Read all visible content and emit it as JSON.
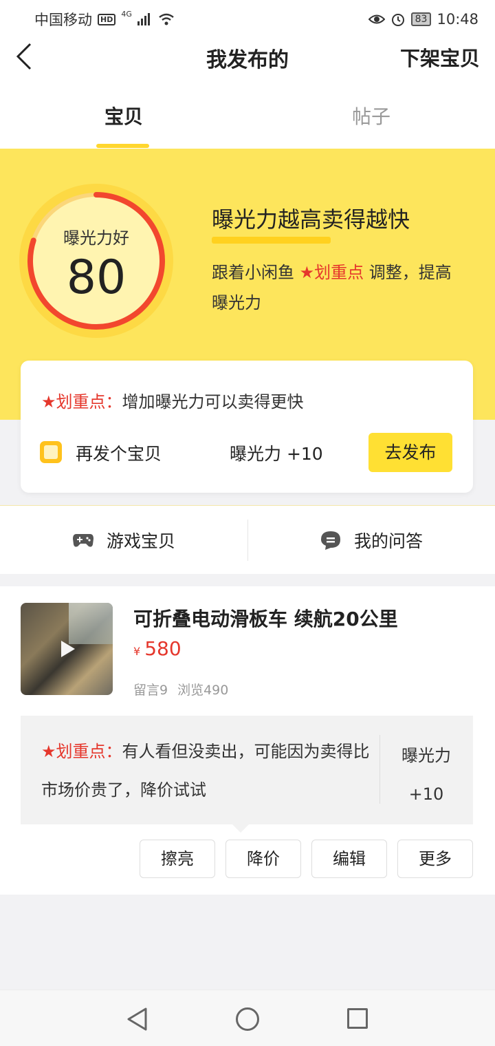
{
  "status_bar": {
    "carrier": "中国移动",
    "hd": "HD",
    "signal": "4G",
    "battery": "83",
    "time": "10:48"
  },
  "header": {
    "title": "我发布的",
    "action": "下架宝贝"
  },
  "tabs": [
    {
      "label": "宝贝",
      "active": true
    },
    {
      "label": "帖子",
      "active": false
    }
  ],
  "exposure": {
    "label": "曝光力好",
    "score": 80,
    "score_text": "80",
    "headline": "曝光力越高卖得越快",
    "desc_prefix": "跟着小闲鱼 ",
    "desc_highlight": "★划重点",
    "desc_suffix": " 调整，提高曝光力"
  },
  "tip_card": {
    "tag": "★划重点：",
    "text": "增加曝光力可以卖得更快",
    "repost_label": "再发个宝贝",
    "repost_gain": "曝光力 +10",
    "publish_button": "去发布"
  },
  "shortcuts": [
    {
      "label": "游戏宝贝",
      "icon": "gamepad-icon"
    },
    {
      "label": "我的问答",
      "icon": "chat-bubble-icon"
    }
  ],
  "item": {
    "title": "可折叠电动滑板车 续航20公里",
    "currency": "¥",
    "price": "580",
    "comments": "留言9",
    "views": "浏览490",
    "advice_tag": "★划重点：",
    "advice_text": "有人看但没卖出，可能因为卖得比市场价贵了，降价试试",
    "advice_gain_label": "曝光力",
    "advice_gain_value": "+10",
    "actions": [
      "擦亮",
      "降价",
      "编辑",
      "更多"
    ]
  },
  "colors": {
    "brand_yellow": "#fde55c",
    "button_yellow": "#ffe033",
    "accent_red": "#e5372c",
    "gauge_orange": "#ff7a2e"
  }
}
